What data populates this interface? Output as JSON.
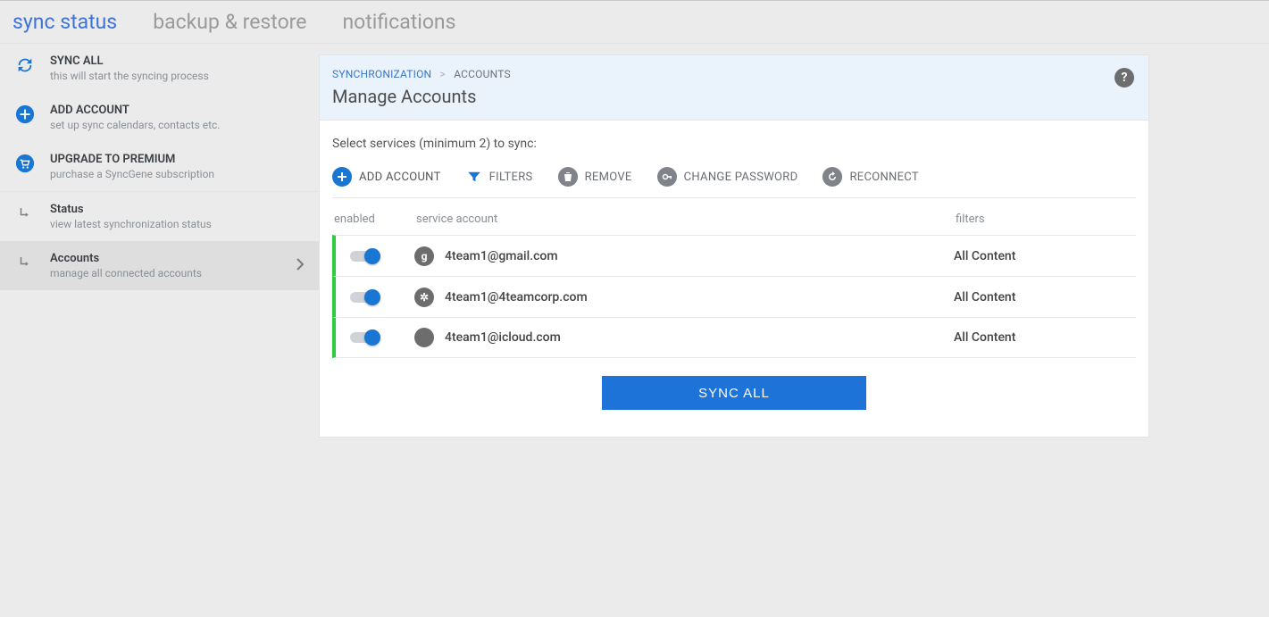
{
  "tabs": {
    "sync_status": "sync status",
    "backup_restore": "backup & restore",
    "notifications": "notifications"
  },
  "sidebar": {
    "sync_all": {
      "title": "SYNC ALL",
      "sub": "this will start the syncing process"
    },
    "add_account": {
      "title": "ADD ACCOUNT",
      "sub": "set up sync calendars, contacts etc."
    },
    "upgrade": {
      "title": "UPGRADE TO PREMIUM",
      "sub": "purchase a SyncGene subscription"
    },
    "status": {
      "title": "Status",
      "sub": "view latest synchronization status"
    },
    "accounts": {
      "title": "Accounts",
      "sub": "manage all connected accounts"
    }
  },
  "breadcrumb": {
    "parent": "SYNCHRONIZATION",
    "current": "ACCOUNTS"
  },
  "page_title": "Manage Accounts",
  "subtitle": "Select services (minimum 2) to sync:",
  "toolbar": {
    "add_account": "ADD ACCOUNT",
    "filters": "FILTERS",
    "remove": "REMOVE",
    "change_password": "CHANGE PASSWORD",
    "reconnect": "RECONNECT"
  },
  "columns": {
    "enabled": "enabled",
    "service_account": "service account",
    "filters": "filters"
  },
  "rows": [
    {
      "service": "google",
      "glyph": "g",
      "account": "4team1@gmail.com",
      "filters": "All Content",
      "enabled": true
    },
    {
      "service": "exchange",
      "glyph": "✲",
      "account": "4team1@4teamcorp.com",
      "filters": "All Content",
      "enabled": true
    },
    {
      "service": "icloud",
      "glyph": "",
      "account": "4team1@icloud.com",
      "filters": "All Content",
      "enabled": true
    }
  ],
  "sync_button": "SYNC ALL",
  "help_tooltip": "?"
}
